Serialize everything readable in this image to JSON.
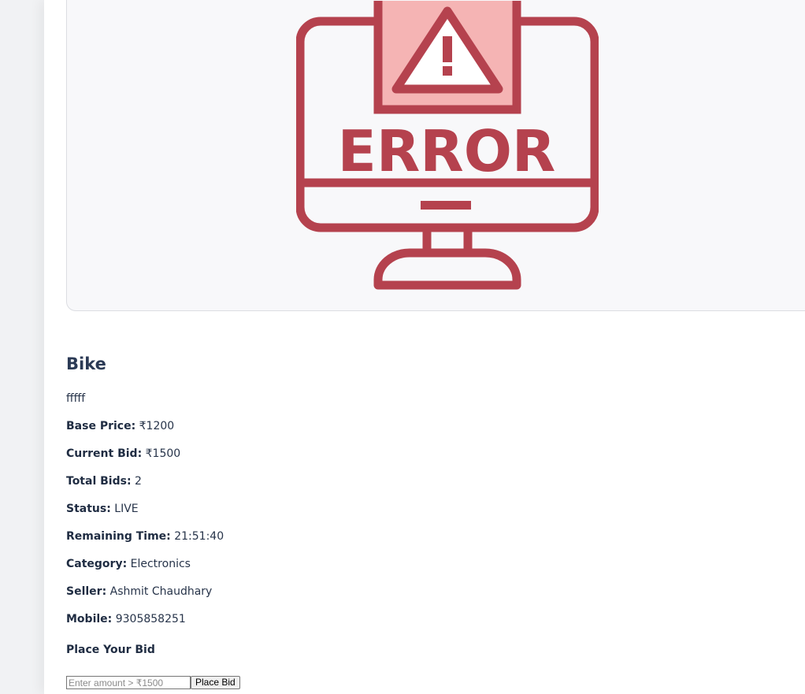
{
  "product": {
    "image_label": "ERROR",
    "title": "Bike",
    "description": "fffff",
    "fields": [
      {
        "label": "Base Price:",
        "value": "₹1200"
      },
      {
        "label": "Current Bid:",
        "value": "₹1500"
      },
      {
        "label": "Total Bids:",
        "value": "2"
      },
      {
        "label": "Status:",
        "value": "LIVE"
      },
      {
        "label": "Remaining Time:",
        "value": "21:51:40"
      },
      {
        "label": "Category:",
        "value": "Electronics"
      },
      {
        "label": "Seller:",
        "value": "Ashmit Chaudhary"
      },
      {
        "label": "Mobile:",
        "value": "9305858251"
      }
    ]
  },
  "bid": {
    "heading": "Place Your Bid",
    "input_placeholder": "Enter amount > ₹1500",
    "button_label": "Place Bid"
  },
  "colors": {
    "error_red": "#b5424e",
    "error_pink": "#f5b4b4",
    "text_dark": "#27344a"
  },
  "icons": {
    "product_image": "error-monitor-icon"
  }
}
